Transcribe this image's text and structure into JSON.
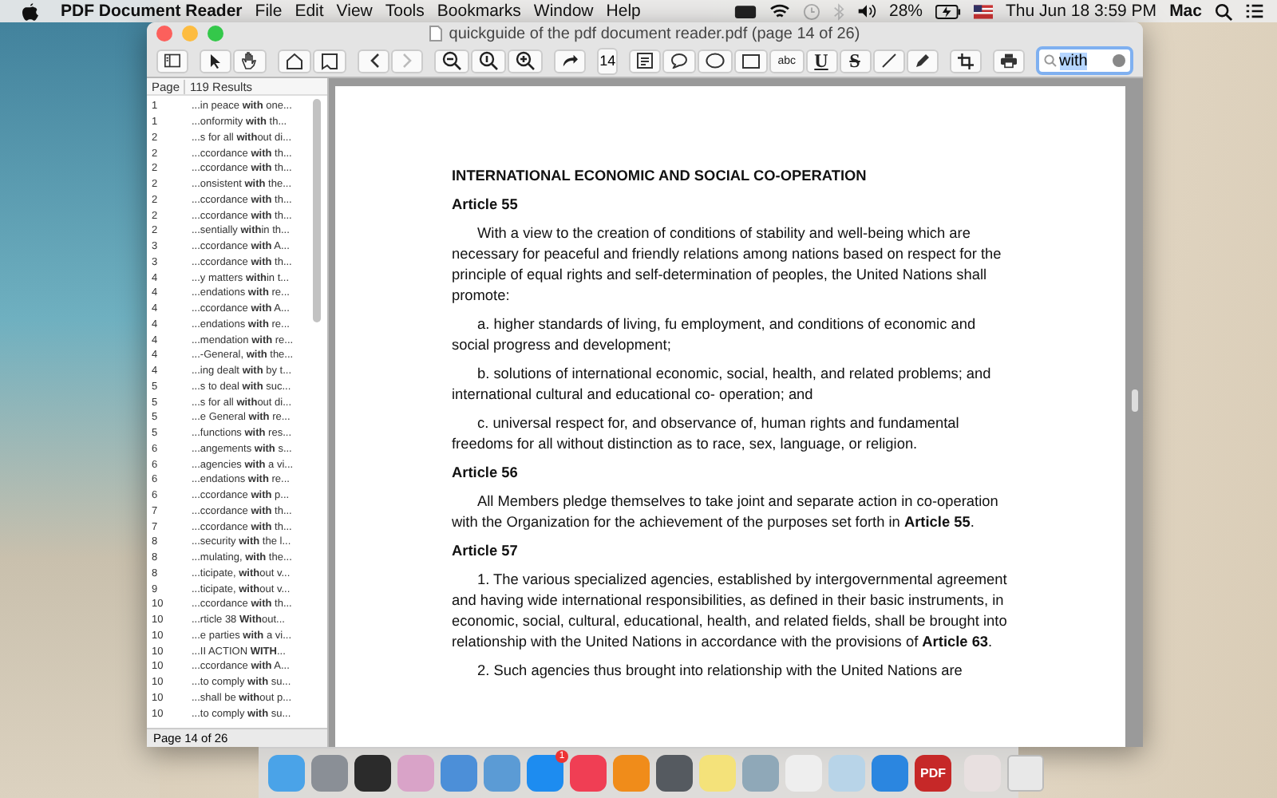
{
  "menubar": {
    "app": "PDF Document Reader",
    "menus": [
      "File",
      "Edit",
      "View",
      "Tools",
      "Bookmarks",
      "Window",
      "Help"
    ],
    "battery": "28%",
    "clock": "Thu Jun 18  3:59 PM",
    "user": "Mac"
  },
  "window": {
    "title": "quickguide of the pdf document reader.pdf (page 14 of 26)"
  },
  "toolbar": {
    "page": "14",
    "text_tool": "abc",
    "underline": "U",
    "strike": "S",
    "search": "with"
  },
  "sidebar": {
    "columns": [
      "Page",
      "119 Results"
    ],
    "rows": [
      {
        "page": "1",
        "text": "...in peace **with** one..."
      },
      {
        "page": "1",
        "text": "...onformity **with** th..."
      },
      {
        "page": "2",
        "text": "...s for all **with**out di..."
      },
      {
        "page": "2",
        "text": "...ccordance **with** th..."
      },
      {
        "page": "2",
        "text": "...ccordance **with** th..."
      },
      {
        "page": "2",
        "text": "...onsistent **with** the..."
      },
      {
        "page": "2",
        "text": "...ccordance **with** th..."
      },
      {
        "page": "2",
        "text": "...ccordance **with** th..."
      },
      {
        "page": "2",
        "text": "...sentially **with**in th..."
      },
      {
        "page": "3",
        "text": "...ccordance **with** A..."
      },
      {
        "page": "3",
        "text": "...ccordance **with** th..."
      },
      {
        "page": "4",
        "text": "...y matters **with**in t..."
      },
      {
        "page": "4",
        "text": "...endations **with** re..."
      },
      {
        "page": "4",
        "text": "...ccordance **with** A..."
      },
      {
        "page": "4",
        "text": "...endations **with** re..."
      },
      {
        "page": "4",
        "text": "...mendation **with** re..."
      },
      {
        "page": "4",
        "text": "...-General, **with** the..."
      },
      {
        "page": "4",
        "text": "...ing dealt **with** by t..."
      },
      {
        "page": "5",
        "text": "...s to deal **with** suc..."
      },
      {
        "page": "5",
        "text": "...s for all **with**out di..."
      },
      {
        "page": "5",
        "text": "...e General **with** re..."
      },
      {
        "page": "5",
        "text": "...functions **with** res..."
      },
      {
        "page": "6",
        "text": "...angements **with** s..."
      },
      {
        "page": "6",
        "text": "...agencies **with** a vi..."
      },
      {
        "page": "6",
        "text": "...endations **with** re..."
      },
      {
        "page": "6",
        "text": "...ccordance **with** p..."
      },
      {
        "page": "7",
        "text": "...ccordance **with** th..."
      },
      {
        "page": "7",
        "text": "...ccordance **with** th..."
      },
      {
        "page": "8",
        "text": "...security **with** the l..."
      },
      {
        "page": "8",
        "text": "...mulating, **with** the..."
      },
      {
        "page": "8",
        "text": "...ticipate, **with**out v..."
      },
      {
        "page": "9",
        "text": "...ticipate, **with**out v..."
      },
      {
        "page": "10",
        "text": "...ccordance **with** th..."
      },
      {
        "page": "10",
        "text": "...rticle 38 **With**out..."
      },
      {
        "page": "10",
        "text": "...e parties **with** a vi..."
      },
      {
        "page": "10",
        "text": "...II ACTION **WITH**..."
      },
      {
        "page": "10",
        "text": "...ccordance **with** A..."
      },
      {
        "page": "10",
        "text": "...to comply **with** su..."
      },
      {
        "page": "10",
        "text": "...shall be **with**out p..."
      },
      {
        "page": "10",
        "text": "...to comply **with** su..."
      }
    ],
    "footer": "Page 14 of 26"
  },
  "document": [
    {
      "kind": "title",
      "text": "INTERNATIONAL ECONOMIC AND SOCIAL CO-OPERATION"
    },
    {
      "kind": "heading",
      "text": "Article 55"
    },
    {
      "kind": "para",
      "text": "With a view to the creation of conditions of stability and well-being which are necessary for peaceful and friendly relations among nations based on respect for the principle of equal rights and self-determination of peoples, the United Nations shall promote:"
    },
    {
      "kind": "para",
      "text": "a. higher standards of living, fu employment, and conditions of economic and social progress and development;"
    },
    {
      "kind": "para",
      "text": "b. solutions of international economic, social, health, and related problems; and international cultural and educational co- operation; and"
    },
    {
      "kind": "para",
      "text": "c. universal respect for, and observance of, human rights and fundamental freedoms for all without distinction as to race, sex, language, or religion."
    },
    {
      "kind": "heading",
      "text": "Article 56"
    },
    {
      "kind": "para",
      "text": "All Members pledge themselves to take joint and separate action in co-operation with the Organization for the achievement of the purposes set forth in **Article 55**."
    },
    {
      "kind": "heading",
      "text": "Article 57"
    },
    {
      "kind": "para",
      "text": "1. The various specialized agencies, established by intergovernmental agreement and having wide international responsibilities, as defined in their basic instruments, in economic, social, cultural, educational, health, and related fields, shall be brought into relationship with the United Nations in accordance with the provisions of **Article 63**."
    },
    {
      "kind": "para",
      "text": "2. Such agencies thus brought into relationship with the United Nations are"
    }
  ],
  "dock": {
    "badge": "1",
    "pdf_label": "PDF"
  }
}
